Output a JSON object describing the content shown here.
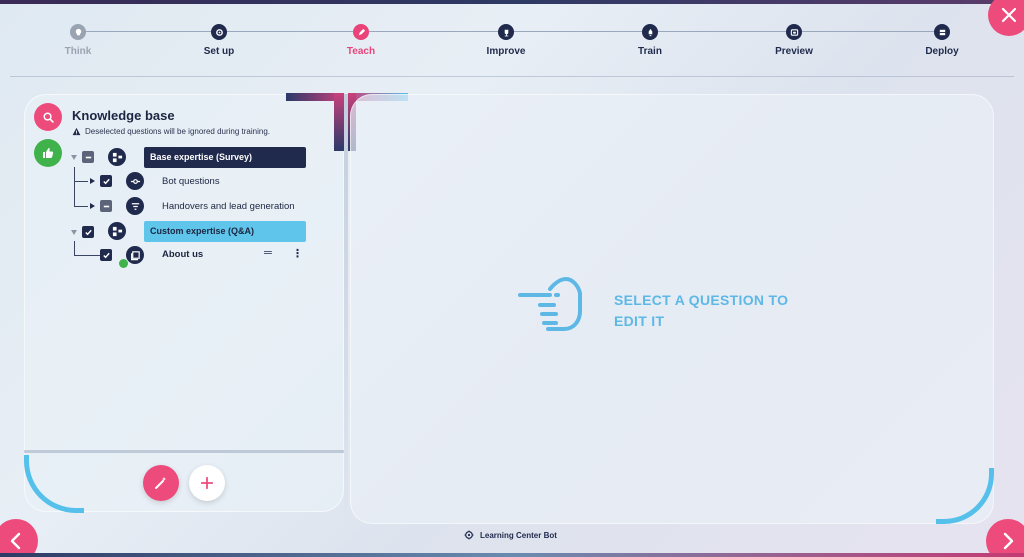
{
  "stepper": {
    "steps": [
      {
        "label": "Think",
        "state": "inactive",
        "icon": "lightbulb-icon"
      },
      {
        "label": "Set up",
        "state": "done",
        "icon": "gear-icon"
      },
      {
        "label": "Teach",
        "state": "active",
        "icon": "pencil-icon"
      },
      {
        "label": "Improve",
        "state": "done",
        "icon": "trophy-icon"
      },
      {
        "label": "Train",
        "state": "done",
        "icon": "rocket-icon"
      },
      {
        "label": "Preview",
        "state": "done",
        "icon": "window-icon"
      },
      {
        "label": "Deploy",
        "state": "done",
        "icon": "server-icon"
      }
    ]
  },
  "knowledge_base": {
    "title": "Knowledge base",
    "note": "Deselected questions will be ignored during training.",
    "groups": [
      {
        "label": "Base expertise (Survey)",
        "checked": "partial",
        "children": [
          {
            "label": "Bot questions",
            "checked": true,
            "icon": "connector-icon"
          },
          {
            "label": "Handovers and lead generation",
            "checked": "partial",
            "icon": "filter-icon"
          }
        ]
      },
      {
        "label": "Custom expertise (Q&A)",
        "checked": true,
        "children": [
          {
            "label": "About us",
            "checked": true,
            "icon": "book-icon"
          }
        ]
      }
    ]
  },
  "editor": {
    "empty_text": "SELECT A QUESTION TO EDIT IT"
  },
  "footer": {
    "bot_name": "Learning Center Bot"
  },
  "colors": {
    "accent": "#ec4b7b",
    "navy": "#1f2a4d",
    "sky": "#5fc5ea",
    "success": "#3fb24b"
  }
}
